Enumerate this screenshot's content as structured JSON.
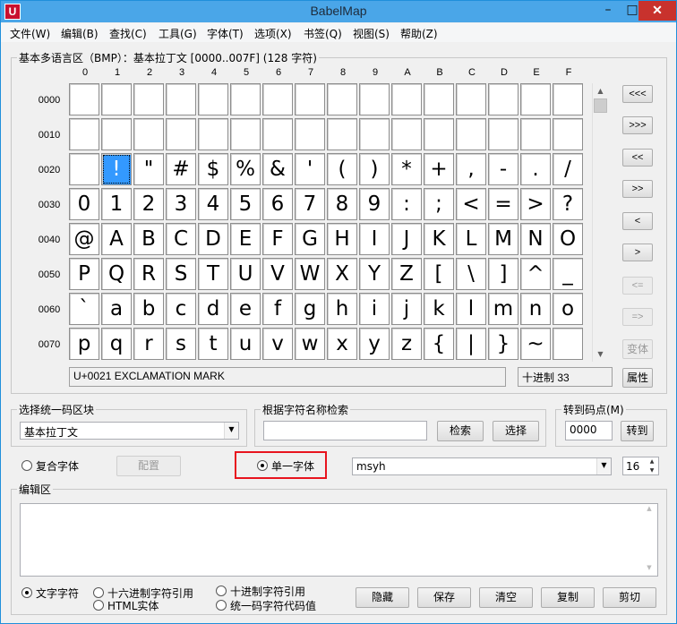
{
  "window": {
    "title": "BabelMap",
    "icon_letter": "U"
  },
  "menu": [
    "文件(W)",
    "编辑(B)",
    "查找(C)",
    "工具(G)",
    "字体(T)",
    "选项(X)",
    "书签(Q)",
    "视图(S)",
    "帮助(Z)"
  ],
  "grid": {
    "header": "基本多语言区（BMP）：基本拉丁文 [0000..007F] (128 字符)",
    "columns": [
      "0",
      "1",
      "2",
      "3",
      "4",
      "5",
      "6",
      "7",
      "8",
      "9",
      "A",
      "B",
      "C",
      "D",
      "E",
      "F"
    ],
    "rows": [
      {
        "label": "0000",
        "cells": [
          "",
          "",
          "",
          "",
          "",
          "",
          "",
          "",
          "",
          "",
          "",
          "",
          "",
          "",
          "",
          ""
        ]
      },
      {
        "label": "0010",
        "cells": [
          "",
          "",
          "",
          "",
          "",
          "",
          "",
          "",
          "",
          "",
          "",
          "",
          "",
          "",
          "",
          ""
        ]
      },
      {
        "label": "0020",
        "cells": [
          "",
          "!",
          "\"",
          "#",
          "$",
          "%",
          "&",
          "'",
          "(",
          ")",
          "*",
          "+",
          ",",
          "-",
          ".",
          "/"
        ]
      },
      {
        "label": "0030",
        "cells": [
          "0",
          "1",
          "2",
          "3",
          "4",
          "5",
          "6",
          "7",
          "8",
          "9",
          ":",
          ";",
          "<",
          "=",
          ">",
          "?"
        ]
      },
      {
        "label": "0040",
        "cells": [
          "@",
          "A",
          "B",
          "C",
          "D",
          "E",
          "F",
          "G",
          "H",
          "I",
          "J",
          "K",
          "L",
          "M",
          "N",
          "O"
        ]
      },
      {
        "label": "0050",
        "cells": [
          "P",
          "Q",
          "R",
          "S",
          "T",
          "U",
          "V",
          "W",
          "X",
          "Y",
          "Z",
          "[",
          "\\",
          "]",
          "^",
          "_"
        ]
      },
      {
        "label": "0060",
        "cells": [
          "`",
          "a",
          "b",
          "c",
          "d",
          "e",
          "f",
          "g",
          "h",
          "i",
          "j",
          "k",
          "l",
          "m",
          "n",
          "o"
        ]
      },
      {
        "label": "0070",
        "cells": [
          "p",
          "q",
          "r",
          "s",
          "t",
          "u",
          "v",
          "w",
          "x",
          "y",
          "z",
          "{",
          "|",
          "}",
          "~",
          ""
        ]
      }
    ],
    "selected": "U+0021"
  },
  "nav_buttons": [
    "<<<",
    ">>>",
    "<<",
    ">>",
    "<",
    ">",
    "<=",
    "=>"
  ],
  "nav_buttons_enabled": [
    true,
    true,
    true,
    true,
    true,
    true,
    false,
    false
  ],
  "side_buttons": {
    "variant": "变体",
    "properties": "属性"
  },
  "status": {
    "char_name": "U+0021 EXCLAMATION MARK",
    "decimal": "十进制 33"
  },
  "block_select": {
    "label": "选择统一码区块",
    "value": "基本拉丁文"
  },
  "name_search": {
    "label": "根据字符名称检索",
    "value": "",
    "search_button": "检索",
    "select_button": "选择"
  },
  "goto": {
    "label": "转到码点(M)",
    "value": "0000",
    "button": "转到"
  },
  "font_mode": {
    "composite_label": "复合字体",
    "config_button": "配置",
    "single_label": "单一字体",
    "selected": "single",
    "font_name": "msyh",
    "font_size": "16"
  },
  "edit": {
    "label": "编辑区",
    "content": "",
    "options": [
      "文字字符",
      "十六进制字符引用",
      "十进制字符引用",
      "HTML实体",
      "统一码字符代码值"
    ],
    "selected_option": "文字字符",
    "buttons": [
      "隐藏",
      "保存",
      "清空",
      "复制",
      "剪切"
    ]
  },
  "colors": {
    "titlebar": "#4aa6e8",
    "close": "#c8322d",
    "selection": "#3399ff",
    "highlight_box": "#e8141e"
  }
}
